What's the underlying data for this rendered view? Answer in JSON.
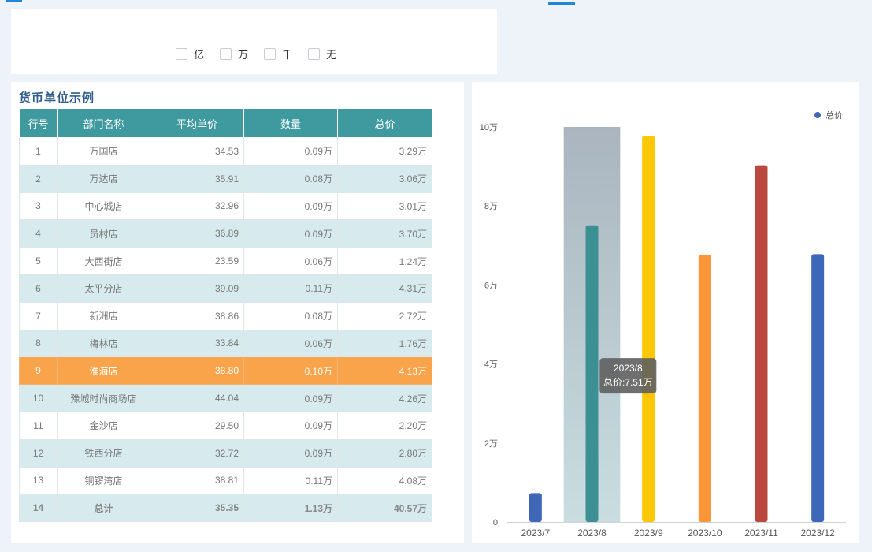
{
  "units": [
    {
      "label": "亿"
    },
    {
      "label": "万"
    },
    {
      "label": "千"
    },
    {
      "label": "无"
    }
  ],
  "table": {
    "title": "货币单位示例",
    "headers": [
      "行号",
      "部门名称",
      "平均单价",
      "数量",
      "总价"
    ],
    "rows": [
      [
        "1",
        "万国店",
        "34.53",
        "0.09万",
        "3.29万"
      ],
      [
        "2",
        "万达店",
        "35.91",
        "0.08万",
        "3.06万"
      ],
      [
        "3",
        "中心城店",
        "32.96",
        "0.09万",
        "3.01万"
      ],
      [
        "4",
        "员村店",
        "36.89",
        "0.09万",
        "3.70万"
      ],
      [
        "5",
        "大西街店",
        "23.59",
        "0.06万",
        "1.24万"
      ],
      [
        "6",
        "太平分店",
        "39.09",
        "0.11万",
        "4.31万"
      ],
      [
        "7",
        "新洲店",
        "38.86",
        "0.08万",
        "2.72万"
      ],
      [
        "8",
        "梅林店",
        "33.84",
        "0.06万",
        "1.76万"
      ],
      [
        "9",
        "淮海店",
        "38.80",
        "0.10万",
        "4.13万"
      ],
      [
        "10",
        "豫城时尚商场店",
        "44.04",
        "0.09万",
        "4.26万"
      ],
      [
        "11",
        "金沙店",
        "29.50",
        "0.09万",
        "2.20万"
      ],
      [
        "12",
        "铁西分店",
        "32.72",
        "0.09万",
        "2.80万"
      ],
      [
        "13",
        "铜锣湾店",
        "38.81",
        "0.11万",
        "4.08万"
      ]
    ],
    "highlighted_row": 8,
    "total": [
      "14",
      "总计",
      "35.35",
      "1.13万",
      "40.57万"
    ]
  },
  "chart_data": {
    "type": "bar",
    "categories": [
      "2023/7",
      "2023/8",
      "2023/9",
      "2023/10",
      "2023/11",
      "2023/12"
    ],
    "series": [
      {
        "name": "总价",
        "values": [
          0.73,
          7.51,
          9.78,
          6.76,
          9.03,
          6.78
        ]
      }
    ],
    "y_ticks": [
      "0",
      "2万",
      "4万",
      "6万",
      "8万",
      "10万"
    ],
    "ylim": [
      0,
      10
    ],
    "legend": "top-right",
    "bar_colors": [
      "#3f66b7",
      "#3c8f92",
      "#fcc805",
      "#fa9637",
      "#b9493f",
      "#3d67b9"
    ],
    "hover_category": "2023/8",
    "tooltip": {
      "title": "2023/8",
      "text": "总价:7.51万"
    }
  }
}
